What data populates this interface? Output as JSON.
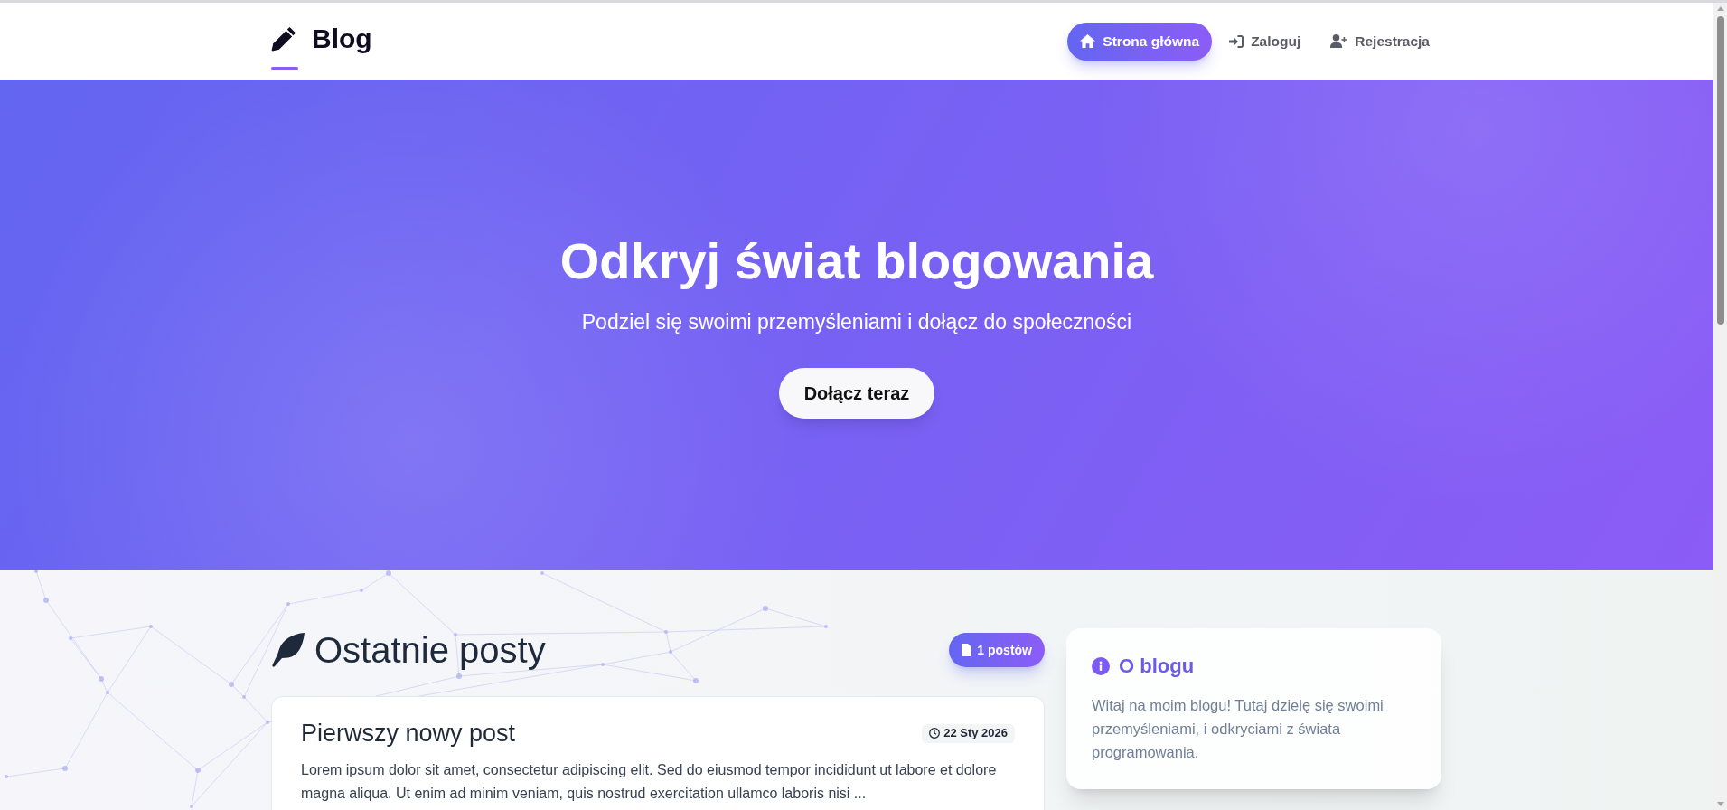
{
  "header": {
    "logo_text": "Blog",
    "nav": [
      {
        "label": "Strona główna",
        "selected": true
      },
      {
        "label": "Zaloguj",
        "selected": false
      },
      {
        "label": "Rejestracja",
        "selected": false
      }
    ]
  },
  "hero": {
    "title": "Odkryj świat blogowania",
    "subtitle": "Podziel się swoimi przemyśleniami i dołącz do społeczności",
    "button": "Dołącz teraz"
  },
  "posts": {
    "heading": "Ostatnie posty",
    "count_badge": "1 postów",
    "items": [
      {
        "title": "Pierwszy nowy post",
        "date": "22 Sty 2026",
        "excerpt": "Lorem ipsum dolor sit amet, consectetur adipiscing elit. Sed do eiusmod tempor incididunt ut labore et dolore magna aliqua. Ut enim ad minim veniam, quis nostrud exercitation ullamco laboris nisi ..."
      }
    ]
  },
  "sidebar": {
    "about": {
      "title": "O blogu",
      "text": "Witaj na moim blogu! Tutaj dzielę się swoimi przemyśleniami, i odkryciami z świata programowania."
    }
  }
}
